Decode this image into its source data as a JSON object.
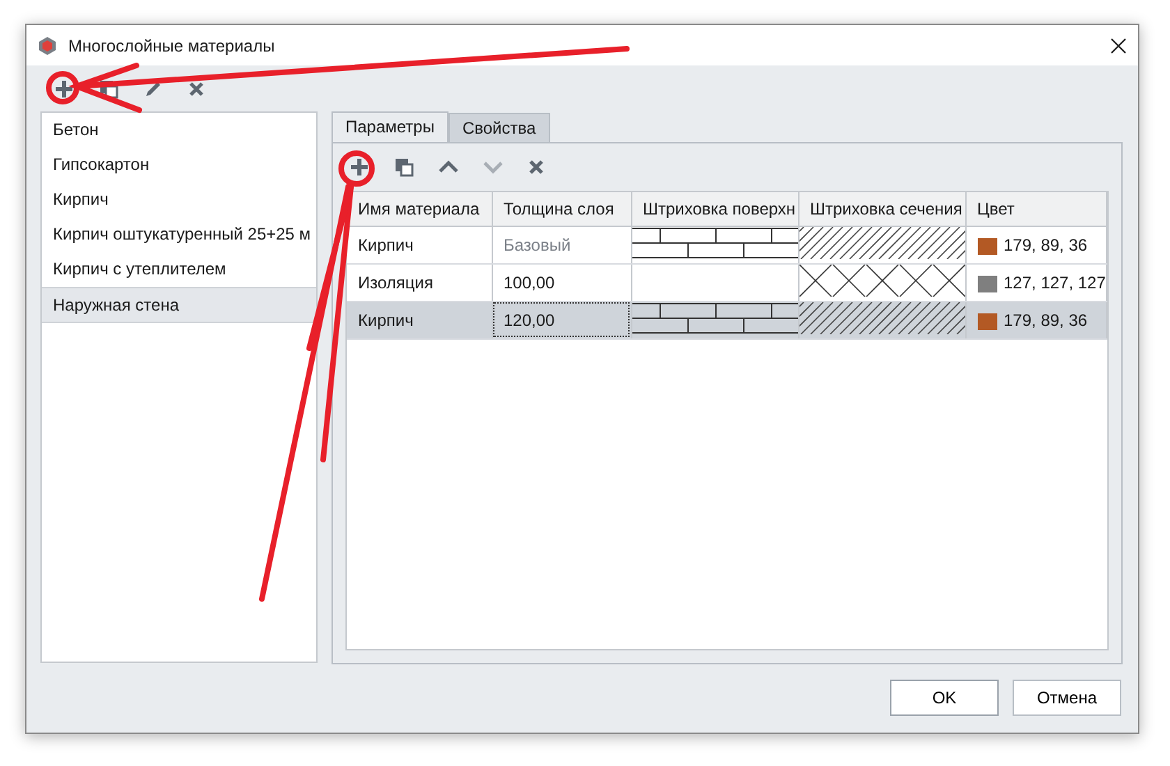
{
  "window": {
    "title": "Многослойные материалы"
  },
  "materials": [
    {
      "label": "Бетон",
      "selected": false
    },
    {
      "label": "Гипсокартон",
      "selected": false
    },
    {
      "label": "Кирпич",
      "selected": false
    },
    {
      "label": "Кирпич оштукатуренный 25+25 м",
      "selected": false
    },
    {
      "label": "Кирпич с утеплителем",
      "selected": false
    },
    {
      "label": "Наружная стена",
      "selected": true
    }
  ],
  "tabs": [
    {
      "label": "Параметры",
      "selected": true
    },
    {
      "label": "Свойства",
      "selected": false
    }
  ],
  "table": {
    "columns": [
      "Имя материала",
      "Толщина слоя",
      "Штриховка поверхн",
      "Штриховка сечения",
      "Цвет"
    ],
    "rows": [
      {
        "name": "Кирпич",
        "thickness": "Базовый",
        "inherited": true,
        "surface_hatch": {
          "kind": "brick"
        },
        "section_hatch": {
          "kind": "diagonal"
        },
        "color": "#b35924",
        "color_text": "179, 89, 36",
        "selected": false
      },
      {
        "name": "Изоляция",
        "thickness": "100,00",
        "inherited": false,
        "surface_hatch": {
          "kind": "none"
        },
        "section_hatch": {
          "kind": "cross"
        },
        "color": "#7f7f7f",
        "color_text": "127, 127, 127",
        "selected": false
      },
      {
        "name": "Кирпич",
        "thickness": "120,00",
        "inherited": false,
        "surface_hatch": {
          "kind": "brick"
        },
        "section_hatch": {
          "kind": "diagonal"
        },
        "color": "#b35924",
        "color_text": "179, 89, 36",
        "selected": true
      }
    ]
  },
  "buttons": [
    {
      "label": "OK",
      "kind": "default"
    },
    {
      "label": "Отмена",
      "kind": "normal"
    }
  ]
}
